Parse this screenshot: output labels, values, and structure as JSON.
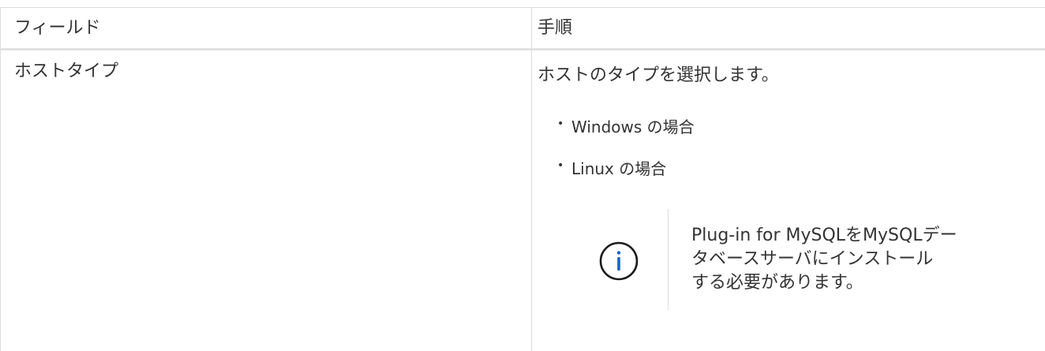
{
  "table": {
    "headers": {
      "field": "フィールド",
      "steps": "手順"
    },
    "rows": [
      {
        "field": "ホストタイプ",
        "description": "ホストのタイプを選択します。",
        "options": [
          "Windows の場合",
          "Linux の場合"
        ],
        "note": {
          "icon": "info-icon",
          "lines": [
            "Plug-in for MySQLをMySQLデー",
            "タベースサーバにインストール",
            "する必要があります。"
          ]
        }
      }
    ]
  },
  "colors": {
    "info_icon": "#1565c0",
    "border": "#dcdcdc",
    "text": "#333333"
  }
}
